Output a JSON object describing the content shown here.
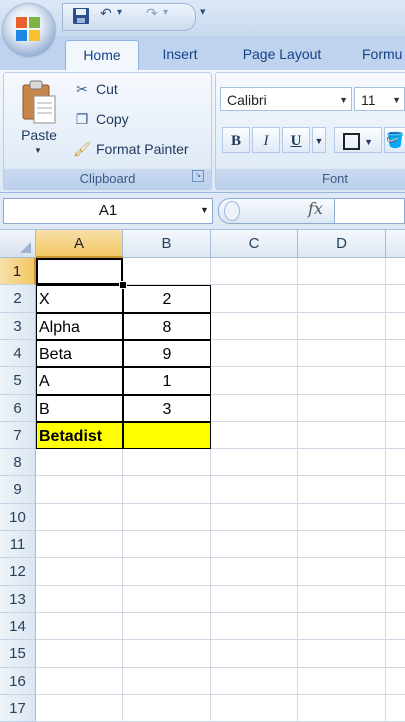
{
  "quick_access": {
    "undo": "↶",
    "redo": "↷",
    "customize": "▾"
  },
  "tabs": [
    {
      "label": "Home",
      "active": true
    },
    {
      "label": "Insert",
      "active": false
    },
    {
      "label": "Page Layout",
      "active": false
    },
    {
      "label": "Formu",
      "active": false
    }
  ],
  "clipboard": {
    "paste_label": "Paste",
    "cut_label": "Cut",
    "copy_label": "Copy",
    "format_painter_label": "Format Painter",
    "group_label": "Clipboard"
  },
  "font_group": {
    "font_name": "Calibri",
    "font_size": "11",
    "bold": "B",
    "italic": "I",
    "underline": "U",
    "group_label": "Font"
  },
  "formula_bar": {
    "name_box": "A1",
    "fx": "fx",
    "formula": ""
  },
  "columns": [
    "A",
    "B",
    "C",
    "D"
  ],
  "rows": [
    "1",
    "2",
    "3",
    "4",
    "5",
    "6",
    "7",
    "8",
    "9",
    "10",
    "11",
    "12",
    "13",
    "14",
    "15",
    "16",
    "17"
  ],
  "cells": {
    "A2": "X",
    "B2": "2",
    "A3": "Alpha",
    "B3": "8",
    "A4": "Beta",
    "B4": "9",
    "A5": "A",
    "B5": "1",
    "A6": "B",
    "B6": "3",
    "A7": "Betadist"
  },
  "colors": {
    "highlight_yellow": "#ffff00",
    "selected_header": "#f3c764",
    "ribbon_blue": "#bfd3ee"
  }
}
